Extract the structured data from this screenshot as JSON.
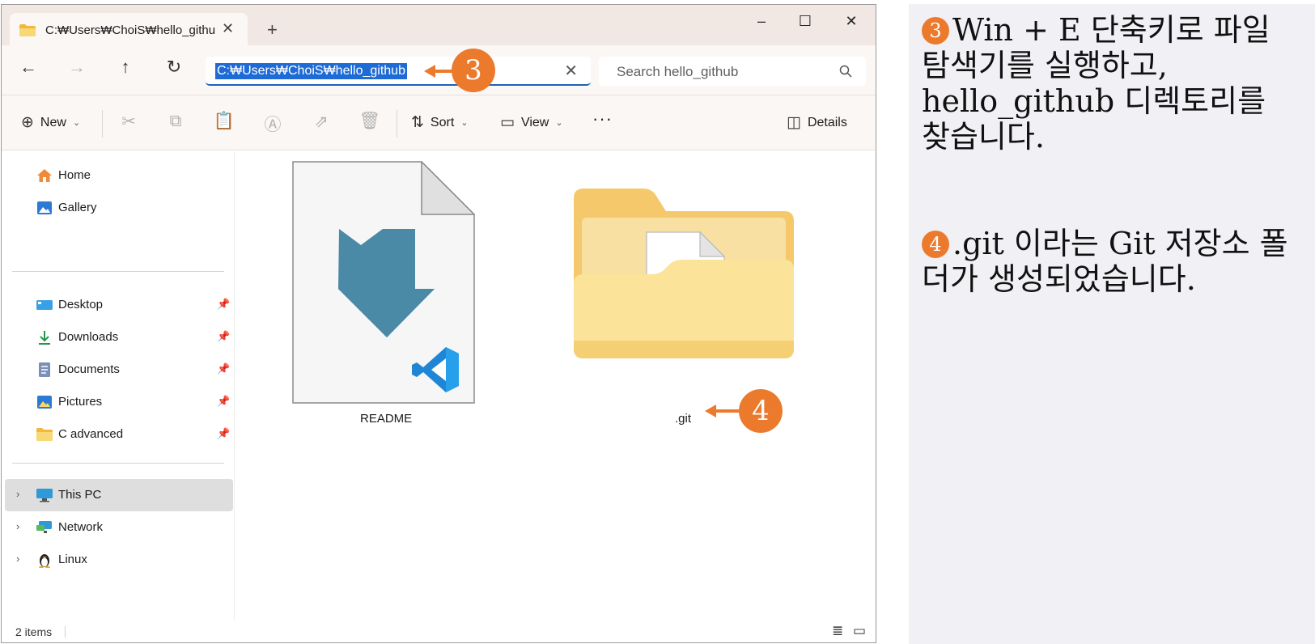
{
  "window": {
    "tab_title": "C:₩Users₩ChoiS₩hello_githu",
    "tab_close": "✕",
    "new_tab": "+",
    "minimize": "–",
    "maximize": "☐",
    "close": "✕"
  },
  "nav": {
    "back": "←",
    "forward": "→",
    "up": "↑",
    "refresh": "↻",
    "address": "C:₩Users₩ChoiS₩hello_github",
    "address_clear": "✕",
    "search_placeholder": "Search hello_github"
  },
  "toolbar": {
    "new_label": "New",
    "sort_label": "Sort",
    "view_label": "View",
    "more": "···",
    "details_label": "Details"
  },
  "sidebar": {
    "home": "Home",
    "gallery": "Gallery",
    "desktop": "Desktop",
    "downloads": "Downloads",
    "documents": "Documents",
    "pictures": "Pictures",
    "c_advanced": "C advanced",
    "this_pc": "This PC",
    "network": "Network",
    "linux": "Linux"
  },
  "files": [
    {
      "name": "README"
    },
    {
      "name": ".git"
    }
  ],
  "status": {
    "item_count": "2 items"
  },
  "callouts": {
    "address_num": "3",
    "git_num": "4"
  },
  "instructions": {
    "step3_num": "3",
    "step3_text": "Win + E 단축키로 파일 탐색기를 실행하고, hello_github 디렉토리를 찾습니다.",
    "step4_num": "4",
    "step4_text": ".git 이라는 Git 저장소 폴더가 생성되었습니다."
  },
  "colors": {
    "accent_orange": "#ec7a2c",
    "selection_blue": "#1f6bd6",
    "folder_yellow": "#f8d775"
  }
}
